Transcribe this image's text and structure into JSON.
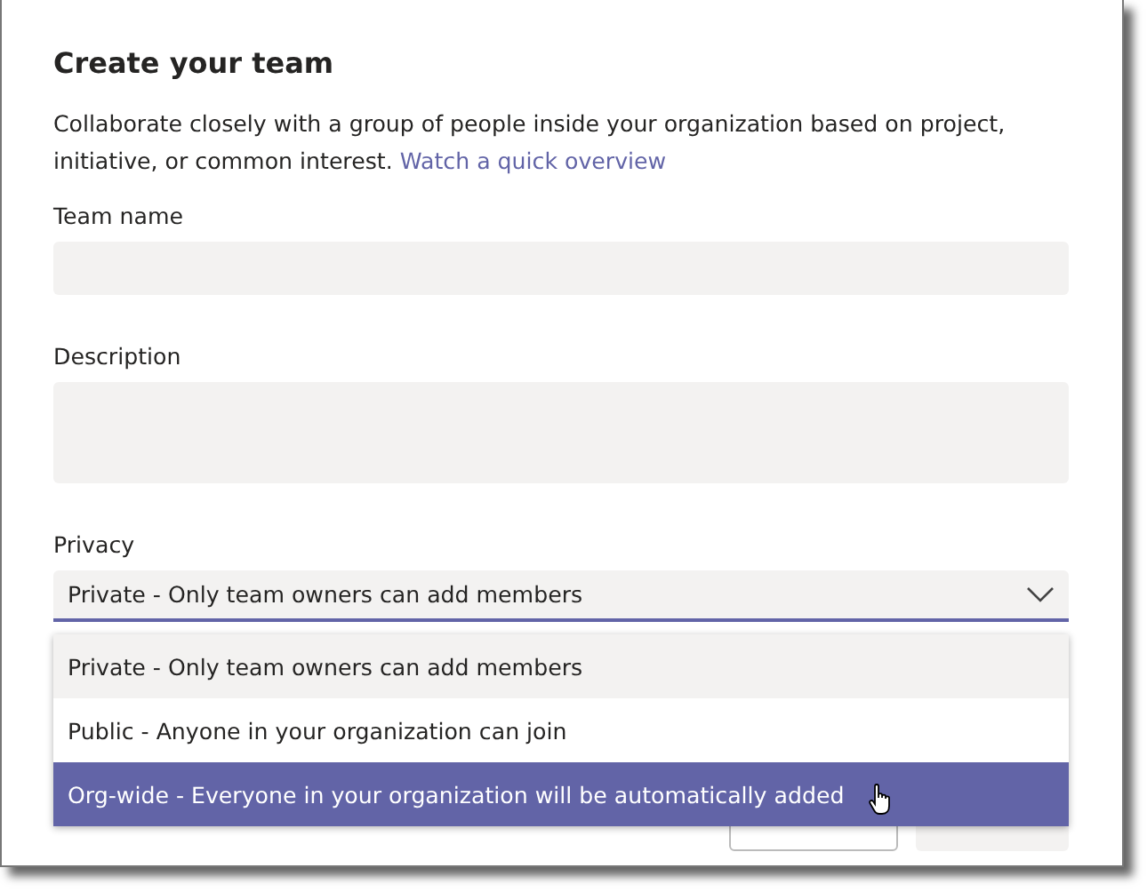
{
  "dialog": {
    "title": "Create your team",
    "description": "Collaborate closely with a group of people inside your organization based on project, initiative, or common interest.",
    "link": "Watch a quick overview"
  },
  "fields": [
    {
      "kind": "input",
      "label": "Team name"
    },
    {
      "kind": "textarea",
      "label": "Description"
    },
    {
      "kind": "select",
      "label": "Privacy",
      "value": "Private - Only team owners can add members",
      "expanded": true
    }
  ],
  "options": [
    {
      "label": "Private - Only team owners can add members",
      "selected": true,
      "hovered": false
    },
    {
      "label": "Public - Anyone in your organization can join",
      "selected": false,
      "hovered": false
    },
    {
      "label": "Org-wide - Everyone in your organization will be automatically added",
      "selected": false,
      "hovered": true
    }
  ]
}
